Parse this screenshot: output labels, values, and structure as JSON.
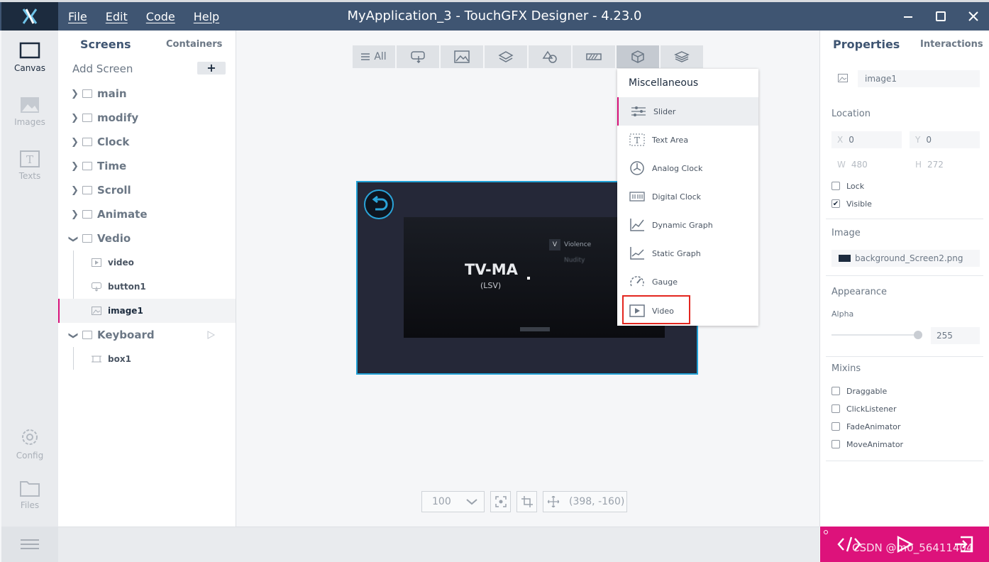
{
  "window": {
    "title": "MyApplication_3 - TouchGFX Designer - 4.23.0",
    "menu": [
      "File",
      "Edit",
      "Code",
      "Help"
    ]
  },
  "rail": {
    "items": [
      {
        "label": "Canvas",
        "icon": "canvas-icon",
        "active": true
      },
      {
        "label": "Images",
        "icon": "images-icon"
      },
      {
        "label": "Texts",
        "icon": "texts-icon"
      },
      {
        "label": "Config",
        "icon": "gear-icon"
      },
      {
        "label": "Files",
        "icon": "folder-icon"
      }
    ]
  },
  "screens_panel": {
    "tab_screens": "Screens",
    "tab_containers": "Containers",
    "add_screen": "Add Screen",
    "add_button": "+",
    "tree": [
      {
        "label": "main",
        "expanded": false
      },
      {
        "label": "modify",
        "expanded": false
      },
      {
        "label": "Clock",
        "expanded": false
      },
      {
        "label": "Time",
        "expanded": false
      },
      {
        "label": "Scroll",
        "expanded": false
      },
      {
        "label": "Animate",
        "expanded": false
      },
      {
        "label": "Vedio",
        "expanded": true,
        "children": [
          "video",
          "button1",
          "image1"
        ]
      },
      {
        "label": "Keyboard",
        "expanded": true,
        "children": [
          "box1"
        ]
      }
    ],
    "selected": "image1"
  },
  "toolbar": {
    "all_label": "All",
    "categories": [
      "buttons-icon",
      "images-icon",
      "containers-icon",
      "shapes-icon",
      "progress-icon",
      "miscellaneous-icon",
      "layers-icon"
    ],
    "active": "miscellaneous-icon"
  },
  "canvas": {
    "preview_title": "TV-MA",
    "preview_subtitle": "(LSV)",
    "rating_items": [
      "Violence",
      "Nudity"
    ],
    "rating_badge": "V",
    "zoom": "100",
    "coords": "(398, -160)"
  },
  "dropdown": {
    "title": "Miscellaneous",
    "items": [
      {
        "label": "Slider",
        "icon": "slider-icon",
        "highlighted": true
      },
      {
        "label": "Text Area",
        "icon": "text-area-icon"
      },
      {
        "label": "Analog Clock",
        "icon": "analog-clock-icon"
      },
      {
        "label": "Digital Clock",
        "icon": "digital-clock-icon"
      },
      {
        "label": "Dynamic Graph",
        "icon": "dynamic-graph-icon"
      },
      {
        "label": "Static Graph",
        "icon": "static-graph-icon"
      },
      {
        "label": "Gauge",
        "icon": "gauge-icon"
      },
      {
        "label": "Video",
        "icon": "video-icon",
        "boxed": true
      }
    ]
  },
  "properties": {
    "tab_properties": "Properties",
    "tab_interactions": "Interactions",
    "name": "image1",
    "location_title": "Location",
    "x_label": "X",
    "x": "0",
    "y_label": "Y",
    "y": "0",
    "w_label": "W",
    "w": "480",
    "h_label": "H",
    "h": "272",
    "lock_label": "Lock",
    "lock": false,
    "visible_label": "Visible",
    "visible": true,
    "image_title": "Image",
    "image_file": "background_Screen2.png",
    "appearance_title": "Appearance",
    "alpha_label": "Alpha",
    "alpha": "255",
    "alpha_fraction": 1.0,
    "mixins_title": "Mixins",
    "mixins": [
      "Draggable",
      "ClickListener",
      "FadeAnimator",
      "MoveAnimator"
    ]
  },
  "watermark": "CSDN @m0_56411404",
  "colors": {
    "titlebar": "#3f5572",
    "accent": "#d8127a",
    "canvas_border": "#21a1d6",
    "highlight_box": "#e3261f"
  }
}
